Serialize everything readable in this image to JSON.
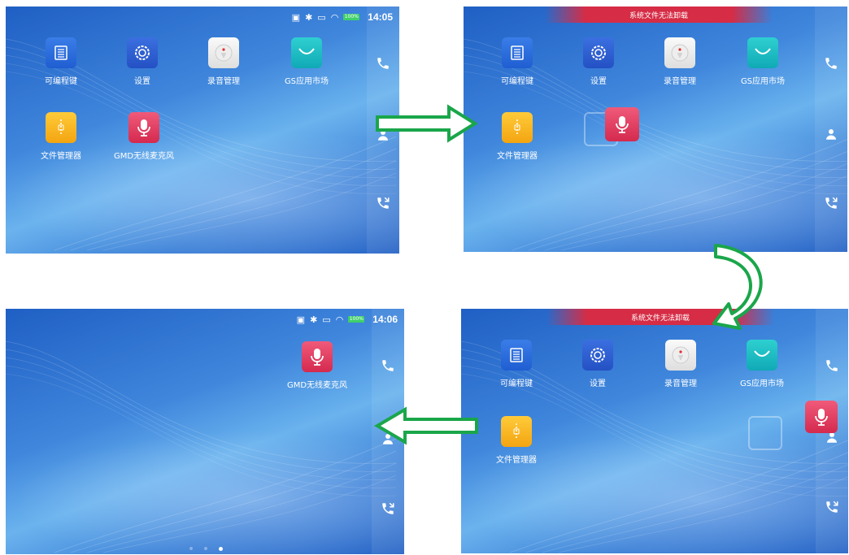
{
  "screens": [
    {
      "status": {
        "time": "14:05",
        "battery": "100%"
      },
      "apps": [
        {
          "label": "可编程键",
          "icon": "keypad-icon"
        },
        {
          "label": "设置",
          "icon": "gear-icon"
        },
        {
          "label": "录音管理",
          "icon": "record-icon"
        },
        {
          "label": "GS应用市场",
          "icon": "shopping-bag-icon"
        },
        {
          "label": "文件管理器",
          "icon": "folder-icon"
        },
        {
          "label": "GMD无线麦克风",
          "icon": "microphone-icon"
        }
      ]
    },
    {
      "banner": "系统文件无法卸载",
      "apps": [
        {
          "label": "可编程键"
        },
        {
          "label": "设置"
        },
        {
          "label": "录音管理"
        },
        {
          "label": "GS应用市场"
        },
        {
          "label": "文件管理器"
        }
      ]
    },
    {
      "banner": "系统文件无法卸载",
      "apps": [
        {
          "label": "可编程键"
        },
        {
          "label": "设置"
        },
        {
          "label": "录音管理"
        },
        {
          "label": "GS应用市场"
        },
        {
          "label": "文件管理器"
        }
      ]
    },
    {
      "status": {
        "time": "14:06",
        "battery": "100%"
      },
      "apps": [
        {
          "label": "GMD无线麦克风"
        }
      ]
    }
  ],
  "colors": {
    "arrow": "#1aa64a",
    "banner": "#d62c45",
    "battery": "#3ecf6a"
  }
}
